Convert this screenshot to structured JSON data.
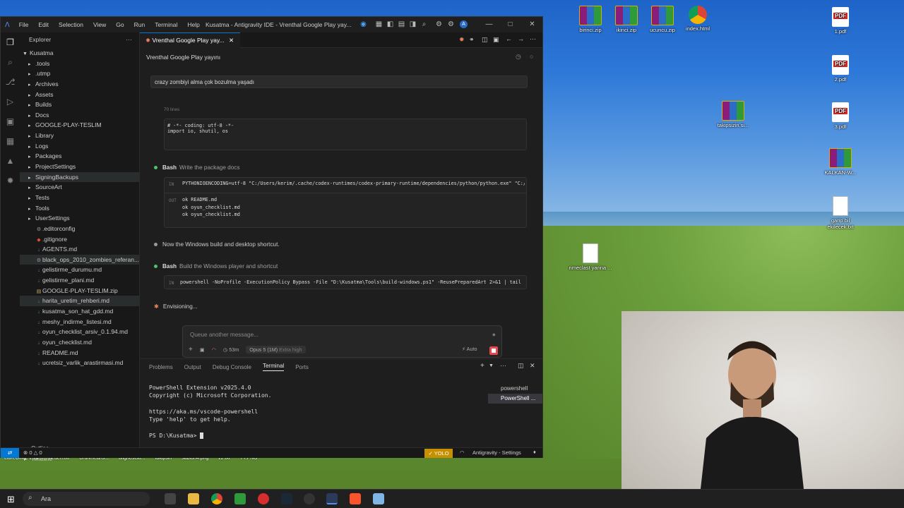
{
  "window": {
    "title": "Kusatma - Antigravity IDE - Vrenthal Google Play yay...",
    "menu": [
      "File",
      "Edit",
      "Selection",
      "View",
      "Go",
      "Run",
      "Terminal",
      "Help"
    ]
  },
  "explorer": {
    "header": "Explorer",
    "root": "Kusatma",
    "items": [
      {
        "label": ".tools",
        "type": "folder"
      },
      {
        "label": ".utmp",
        "type": "folder"
      },
      {
        "label": "Archives",
        "type": "folder"
      },
      {
        "label": "Assets",
        "type": "folder"
      },
      {
        "label": "Builds",
        "type": "folder"
      },
      {
        "label": "Docs",
        "type": "folder"
      },
      {
        "label": "GOOGLE-PLAY-TESLIM",
        "type": "folder"
      },
      {
        "label": "Library",
        "type": "folder"
      },
      {
        "label": "Logs",
        "type": "folder"
      },
      {
        "label": "Packages",
        "type": "folder"
      },
      {
        "label": "ProjectSettings",
        "type": "folder"
      },
      {
        "label": "SigningBackups",
        "type": "folder",
        "sel": true
      },
      {
        "label": "SourceArt",
        "type": "folder"
      },
      {
        "label": "Tests",
        "type": "folder"
      },
      {
        "label": "Tools",
        "type": "folder"
      },
      {
        "label": "UserSettings",
        "type": "folder"
      },
      {
        "label": ".editorconfig",
        "type": "file"
      },
      {
        "label": ".gitignore",
        "type": "file"
      },
      {
        "label": "AGENTS.md",
        "type": "file"
      },
      {
        "label": "black_ops_2010_zombies_referan...",
        "type": "file",
        "sel": true
      },
      {
        "label": "gelistirme_durumu.md",
        "type": "file"
      },
      {
        "label": "gelistirme_plani.md",
        "type": "file"
      },
      {
        "label": "GOOGLE-PLAY-TESLIM.zip",
        "type": "file"
      },
      {
        "label": "harita_uretim_rehberi.md",
        "type": "file",
        "sel": true
      },
      {
        "label": "kusatma_son_hat_gdd.md",
        "type": "file"
      },
      {
        "label": "meshy_indirme_listesi.md",
        "type": "file"
      },
      {
        "label": "oyun_checklist_arsiv_0.1.94.md",
        "type": "file"
      },
      {
        "label": "oyun_checklist.md",
        "type": "file"
      },
      {
        "label": "README.md",
        "type": "file"
      },
      {
        "label": "ucretsiz_varlik_arastirmasi.md",
        "type": "file"
      }
    ],
    "outline": "Outline",
    "timeline": "Timeline"
  },
  "tab": {
    "label": "Vrenthal Google Play yay..."
  },
  "agent": {
    "conversation_title": "Vrenthal Google Play yayını",
    "user_message": "crazy zombiyi alma çok bozulma yaşadı",
    "lines_note": "70 lines",
    "code1": "# -*- coding: utf-8 -*-\nimport io, shutil, os",
    "step1_tool": "Bash",
    "step1_desc": "Write the package docs",
    "cmd1_in": "IN",
    "cmd1": "PYTHONIOENCODING=utf-8 \"C:/Users/kerim/.cache/codex-runtimes/codex-primary-runtime/dependencies/python/python.exe\" \"C:/",
    "cmd1_out": "OUT",
    "out1": "ok README.md\nok oyun_checklist.md\nok oyun_checklist.md",
    "message": "Now the Windows build and desktop shortcut.",
    "step2_tool": "Bash",
    "step2_desc": "Build the Windows player and shortcut",
    "cmd2_in": "IN",
    "cmd2": "powershell -NoProfile -ExecutionPolicy Bypass -File \"D:\\Kusatma\\Tools\\build-windows.ps1\" -ReusePreparedArt 2>&1 | tail -",
    "status": "Envisioning...",
    "composer_placeholder": "Queue another message...",
    "timer": "53m",
    "model": "Opus 5 (1M)",
    "effort": "Extra high",
    "mode": "Auto"
  },
  "panel": {
    "tabs": [
      "Problems",
      "Output",
      "Debug Console",
      "Terminal",
      "Ports"
    ],
    "active_tab": "Terminal",
    "terminal_lines": "PowerShell Extension v2025.4.0\nCopyright (c) Microsoft Corporation.\n\nhttps://aka.ms/vscode-powershell\nType 'help' to get help.\n\nPS D:\\Kusatma> ",
    "terminals": [
      "powershell",
      "PowerShell ..."
    ]
  },
  "statusbar": {
    "errors": "0",
    "warnings": "0",
    "yolo": "YOLO",
    "settings": "Antigravity - Settings"
  },
  "desktop": {
    "icons": [
      {
        "label": "birinci.zip",
        "kind": "rar"
      },
      {
        "label": "ikinci.zip",
        "kind": "rar"
      },
      {
        "label": "ucuncu.zip",
        "kind": "rar"
      },
      {
        "label": "index.html",
        "kind": "chrome"
      },
      {
        "label": "1.pdf",
        "kind": "pdf"
      },
      {
        "label": "2.pdf",
        "kind": "pdf"
      },
      {
        "label": "3.pdf",
        "kind": "pdf"
      },
      {
        "label": "takipsizin.si...",
        "kind": "rar"
      },
      {
        "label": "KALKAN-W...",
        "kind": "rar"
      },
      {
        "label": "garip bil ekilecek.txt",
        "kind": "txt"
      },
      {
        "label": "rimeclast yarina ...",
        "kind": "txt"
      }
    ],
    "bottom_labels": [
      "LibreOffice 26.2",
      "beden.txt",
      "Urunmeans...",
      "bilgnostsu...",
      "takipsin",
      "sablon4.png",
      "zz.txt",
      "TT.PNG"
    ]
  },
  "taskbar": {
    "search": "Ara"
  },
  "colors": {
    "accent": "#0078d4",
    "yolo": "#c69000",
    "stop": "#e5484d",
    "pdf": "#e02828"
  }
}
